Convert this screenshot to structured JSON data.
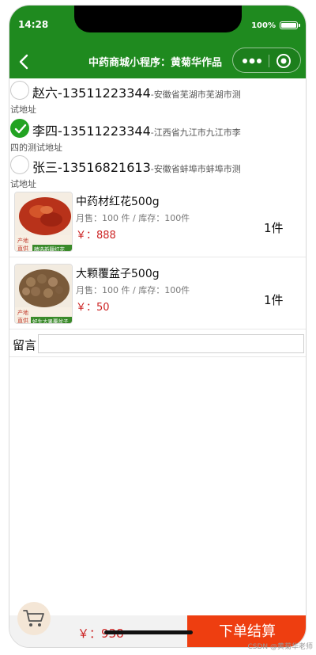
{
  "status": {
    "time": "14:28",
    "battery": "100%"
  },
  "nav": {
    "title": "中药商城小程序：黄菊华作品"
  },
  "addresses": [
    {
      "name_phone": "赵六-13511223344",
      "detail_line1": "-安徽省芜湖市芜湖市测",
      "detail_line2": "试地址",
      "selected": false
    },
    {
      "name_phone": "李四-13511223344",
      "detail_line1": "-江西省九江市九江市李",
      "detail_line2": "四的测试地址",
      "selected": true
    },
    {
      "name_phone": "张三-13516821613",
      "detail_line1": "-安徽省蚌埠市蚌埠市测",
      "detail_line2": "试地址",
      "selected": false
    }
  ],
  "products": [
    {
      "name": "中药材红花500g",
      "meta": "月售：100 件 / 库存：100件",
      "price": "￥：888",
      "qty": "1件",
      "img_text_top": "产地",
      "img_text_bottom": "直供",
      "img_banner": "精选新疆红花"
    },
    {
      "name": "大颗覆盆子500g",
      "meta": "月售：100 件 / 库存：100件",
      "price": "￥：50",
      "qty": "1件",
      "img_text_top": "产地",
      "img_text_bottom": "直供",
      "img_banner": "好生大果覆盆子"
    }
  ],
  "memo": {
    "label": "留言",
    "value": ""
  },
  "footer": {
    "total": "￥：938",
    "checkout_label": "下单结算"
  },
  "watermark": "CSDN @黄菊华老师",
  "colors": {
    "header": "#1f8a1f",
    "price": "#cc2222",
    "checkout": "#ee3e10",
    "radio_checked": "#22a322"
  },
  "icons": [
    "back-arrow-icon",
    "more-dots-icon",
    "close-target-icon",
    "checkmark-icon",
    "cart-icon"
  ]
}
